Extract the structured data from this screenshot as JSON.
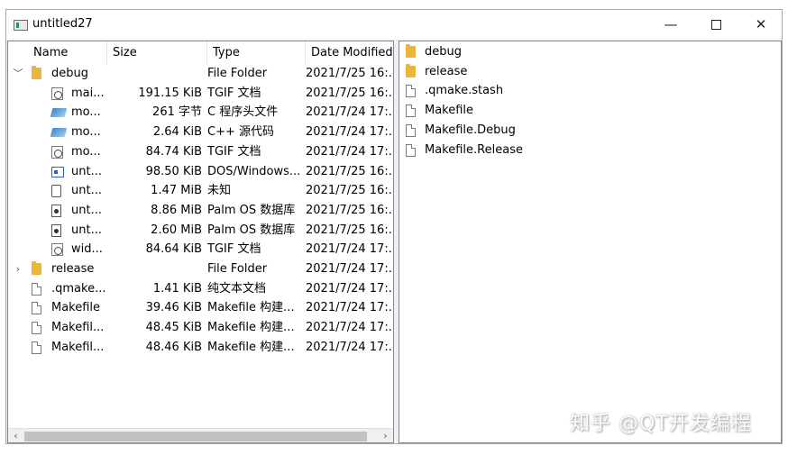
{
  "window": {
    "title": "untitled27",
    "controls": {
      "minimize": "—",
      "maximize": "",
      "close": "✕"
    }
  },
  "tree": {
    "columns": [
      "Name",
      "Size",
      "Type",
      "Date Modified"
    ],
    "rows": [
      {
        "arrow": "﹀",
        "icon": "folder-icon",
        "name": "debug",
        "size": "",
        "type": "File Folder",
        "date": "2021/7/25 16:...",
        "indent": 0
      },
      {
        "arrow": "",
        "icon": "tgif-file-icon",
        "name": "mai...",
        "size": "191.15 KiB",
        "type": "TGIF 文档",
        "date": "2021/7/25 16:...",
        "indent": 1
      },
      {
        "arrow": "",
        "icon": "header-file-icon",
        "name": "mo...",
        "size": "261 字节",
        "type": "C 程序头文件",
        "date": "2021/7/24 17:...",
        "indent": 1
      },
      {
        "arrow": "",
        "icon": "header-file-icon",
        "name": "mo...",
        "size": "2.64 KiB",
        "type": "C++ 源代码",
        "date": "2021/7/24 17:...",
        "indent": 1
      },
      {
        "arrow": "",
        "icon": "tgif-file-icon",
        "name": "mo...",
        "size": "84.74 KiB",
        "type": "TGIF 文档",
        "date": "2021/7/24 17:...",
        "indent": 1
      },
      {
        "arrow": "",
        "icon": "executable-icon",
        "name": "unt...",
        "size": "98.50 KiB",
        "type": "DOS/Windows...",
        "date": "2021/7/25 16:...",
        "indent": 1
      },
      {
        "arrow": "",
        "icon": "unknown-file-icon",
        "name": "unt...",
        "size": "1.47 MiB",
        "type": "未知",
        "date": "2021/7/25 16:...",
        "indent": 1
      },
      {
        "arrow": "",
        "icon": "palm-database-icon",
        "name": "unt...",
        "size": "8.86 MiB",
        "type": "Palm OS 数据库",
        "date": "2021/7/25 16:...",
        "indent": 1
      },
      {
        "arrow": "",
        "icon": "palm-database-icon",
        "name": "unt...",
        "size": "2.60 MiB",
        "type": "Palm OS 数据库",
        "date": "2021/7/25 16:...",
        "indent": 1
      },
      {
        "arrow": "",
        "icon": "tgif-file-icon",
        "name": "wid...",
        "size": "84.64 KiB",
        "type": "TGIF 文档",
        "date": "2021/7/24 17:...",
        "indent": 1
      },
      {
        "arrow": "›",
        "icon": "folder-icon",
        "name": "release",
        "size": "",
        "type": "File Folder",
        "date": "2021/7/24 17:...",
        "indent": 0
      },
      {
        "arrow": "",
        "icon": "text-file-icon",
        "name": ".qmake...",
        "size": "1.41 KiB",
        "type": "纯文本文档",
        "date": "2021/7/24 17:...",
        "indent": 0
      },
      {
        "arrow": "",
        "icon": "text-file-icon",
        "name": "Makefile",
        "size": "39.46 KiB",
        "type": "Makefile 构建...",
        "date": "2021/7/24 17:...",
        "indent": 0
      },
      {
        "arrow": "",
        "icon": "text-file-icon",
        "name": "Makefil...",
        "size": "48.45 KiB",
        "type": "Makefile 构建...",
        "date": "2021/7/24 17:...",
        "indent": 0
      },
      {
        "arrow": "",
        "icon": "text-file-icon",
        "name": "Makefil...",
        "size": "48.46 KiB",
        "type": "Makefile 构建...",
        "date": "2021/7/24 17:...",
        "indent": 0
      }
    ],
    "scroll": {
      "left": "‹",
      "right": "›"
    }
  },
  "list": {
    "items": [
      {
        "icon": "folder-icon",
        "label": "debug"
      },
      {
        "icon": "folder-icon",
        "label": "release"
      },
      {
        "icon": "text-file-icon",
        "label": ".qmake.stash"
      },
      {
        "icon": "text-file-icon",
        "label": "Makefile"
      },
      {
        "icon": "text-file-icon",
        "label": "Makefile.Debug"
      },
      {
        "icon": "text-file-icon",
        "label": "Makefile.Release"
      }
    ]
  },
  "watermark": "知乎 @QT开发编程"
}
